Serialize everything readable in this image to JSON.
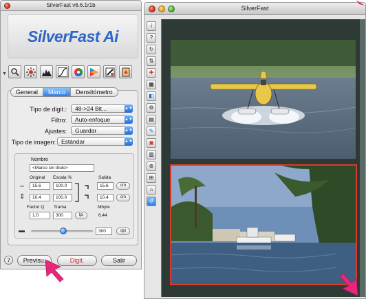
{
  "control_window": {
    "title": "SilverFast v6.6.1r1b",
    "logo": "SilverFast Ai",
    "tabs": [
      "General",
      "Marco",
      "Densitómetro"
    ],
    "active_tab": "Marco",
    "settings": {
      "digit_type": {
        "label": "Tipo de digit.:",
        "value": "48->24 Bit..."
      },
      "filter": {
        "label": "Filtro:",
        "value": "Auto-enfoque"
      },
      "adjust": {
        "label": "Ajustes:",
        "value": "Guardar"
      },
      "image_type": {
        "label": "Tipo de imagen:",
        "value": "Estándar"
      }
    },
    "frame": {
      "name_label": "Nombre",
      "name_value": "<Marco sin título>",
      "original_label": "Original",
      "scale_label": "Escala %",
      "output_label": "Salida",
      "width_original": "15.6",
      "width_scale": "100.0",
      "width_output": "15.6",
      "height_original": "10.4",
      "height_scale": "100.0",
      "height_output": "10.4",
      "unit": "cm",
      "q_factor_label": "Factor Q",
      "q_factor_value": "1.0",
      "screen_label": "Trama",
      "screen_value": "300",
      "screen_unit": "lpi",
      "mbyte_label": "Mbyte",
      "mbyte_value": "6.44",
      "resolution_value": "300",
      "resolution_unit": "dpi"
    },
    "buttons": {
      "preview": "Previsu.",
      "scan": "Digit.",
      "exit": "Salir"
    }
  },
  "preview_window": {
    "title": "SilverFast"
  },
  "colors": {
    "accent": "#2f7ee3",
    "logo": "#2e66c8",
    "selection_frame": "#d93a2c",
    "cursor": "#e8267a",
    "canvas": "#2d3a36"
  }
}
